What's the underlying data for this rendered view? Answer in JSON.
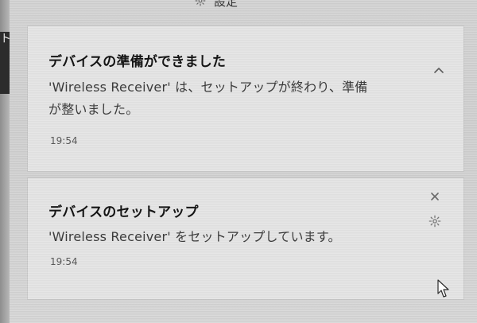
{
  "header": {
    "title": "設定",
    "gear_icon": "gear-icon"
  },
  "left_panel": {
    "tab_label": "ト"
  },
  "notifications": [
    {
      "title": "デバイスの準備ができました",
      "body_line1": "'Wireless Receiver' は、セットアップが終わり、準備",
      "body_line2": "が整いました。",
      "time": "19:54",
      "action_icon": "chevron-up-icon"
    },
    {
      "title": "デバイスのセットアップ",
      "body_line1": "'Wireless Receiver' をセットアップしています。",
      "time": "19:54",
      "action_icons": [
        "close-icon",
        "gear-icon"
      ]
    }
  ],
  "colors": {
    "background": "#cfcfcf",
    "card": "#e3e3e3",
    "title": "#151515",
    "body": "#3b3b3b",
    "time": "#595959"
  }
}
